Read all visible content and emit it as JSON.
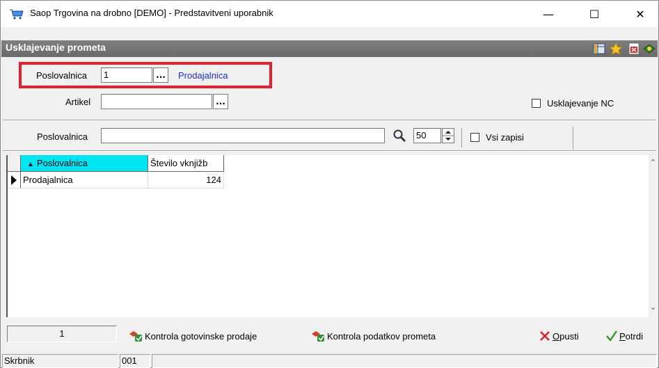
{
  "window": {
    "title": "Saop Trgovina na drobno [DEMO] - Predstavitveni uporabnik",
    "minimize_glyph": "—",
    "maximize_glyph": "☐",
    "close_glyph": "✕"
  },
  "caption": {
    "title": "Usklajevanje prometa",
    "icons": [
      "grid-settings-icon",
      "star-icon",
      "exit-icon",
      "help-icon"
    ]
  },
  "form": {
    "poslovalnica_label": "Poslovalnica",
    "poslovalnica_value": "1",
    "poslovalnica_name": "Prodajalnica",
    "artikel_label": "Artikel",
    "artikel_value": "",
    "browse_label": "...",
    "usklajevanje_nc_label": "Usklajevanje NC",
    "usklajevanje_nc_checked": false
  },
  "filter": {
    "label": "Poslovalnica",
    "value": "",
    "limit": "50",
    "vsi_zapisi_label": "Vsi zapisi",
    "vsi_zapisi_checked": false
  },
  "grid": {
    "sort_glyph": "▲",
    "columns": [
      "Poslovalnica",
      "Število vknjižb"
    ],
    "rows": [
      {
        "poslovalnica": "Prodajalnica",
        "stevilo": "124"
      }
    ]
  },
  "bottom": {
    "count": "1",
    "btn_kontrola_gotovinske_prefix": "Kontrola ",
    "btn_kontrola_gotovinske_underline": "g",
    "btn_kontrola_gotovinske_suffix": "otovinske prodaje",
    "btn_kontrola_podatkov": "Kontrola podatkov prometa",
    "btn_opusti_underline": "O",
    "btn_opusti_rest": "pusti",
    "btn_potrdi_underline": "P",
    "btn_potrdi_rest": "otrdi"
  },
  "status": {
    "user": "Skrbnik",
    "code": "001",
    "extra": ""
  },
  "colors": {
    "header_sorted": "#00e5f4",
    "highlight_border": "#e41f2e",
    "link": "#1a2fd6"
  }
}
